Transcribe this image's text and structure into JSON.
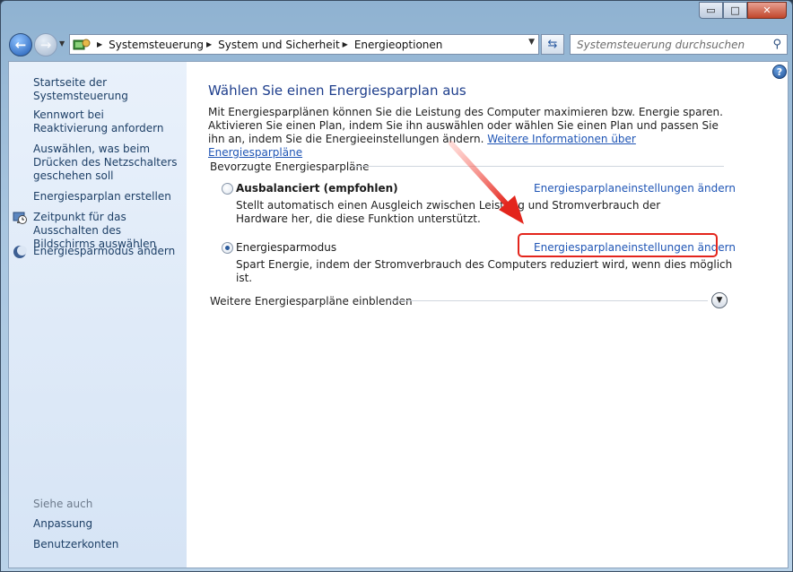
{
  "window": {
    "minimize_glyph": "▭",
    "maximize_glyph": "□",
    "close_glyph": "✕"
  },
  "addressbar": {
    "crumbs": [
      "Systemsteuerung",
      "System und Sicherheit",
      "Energieoptionen"
    ],
    "search_placeholder": "Systemsteuerung durchsuchen"
  },
  "sidebar": {
    "items": [
      {
        "label": "Startseite der Systemsteuerung"
      },
      {
        "label": "Kennwort bei Reaktivierung anfordern"
      },
      {
        "label": "Auswählen, was beim Drücken des Netzschalters geschehen soll"
      },
      {
        "label": "Energiesparplan erstellen"
      },
      {
        "label": "Zeitpunkt für das Ausschalten des Bildschirms auswählen",
        "icon": "monitor-clock-icon"
      },
      {
        "label": "Energiesparmodus ändern",
        "icon": "moon-icon"
      }
    ],
    "see_also": "Siehe auch",
    "see_also_items": [
      {
        "label": "Anpassung"
      },
      {
        "label": "Benutzerkonten"
      }
    ]
  },
  "main": {
    "title": "Wählen Sie einen Energiesparplan aus",
    "intro": "Mit Energiesparplänen können Sie die Leistung des Computer maximieren bzw. Energie sparen. Aktivieren Sie einen Plan, indem Sie ihn auswählen oder wählen Sie einen Plan und passen Sie ihn an, indem Sie die Energieeinstellungen ändern.",
    "intro_link": "Weitere Informationen über Energiesparpläne",
    "group_label": "Bevorzugte Energiesparpläne",
    "plans": [
      {
        "name": "Ausbalanciert (empfohlen)",
        "selected": false,
        "description": "Stellt automatisch einen Ausgleich zwischen Leistung und Stromverbrauch der Hardware her, die diese Funktion unterstützt.",
        "link": "Energiesparplaneinstellungen ändern"
      },
      {
        "name": "Energiesparmodus",
        "selected": true,
        "description": "Spart Energie, indem der Stromverbrauch des Computers reduziert wird, wenn dies möglich ist.",
        "link": "Energiesparplaneinstellungen ändern"
      }
    ],
    "more_plans_label": "Weitere Energiesparpläne einblenden"
  },
  "colors": {
    "link": "#1f55b5",
    "title": "#1e3e8c",
    "annotation": "#e3251c"
  }
}
